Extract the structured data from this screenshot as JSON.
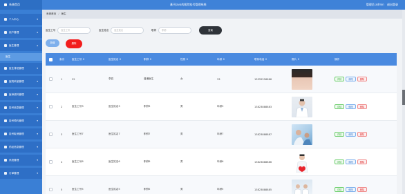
{
  "topbar": {
    "brand": "系统首页",
    "title": "基于Java的医院挂号管理系统",
    "user_role": "管理员 admin",
    "logout": "退出登录"
  },
  "sidebar": {
    "items": [
      {
        "label": "个人中心",
        "icon": "user-icon"
      },
      {
        "label": "用户管理",
        "icon": "users-icon"
      },
      {
        "label": "医生管理",
        "icon": "doctor-icon",
        "expanded": true,
        "sub": "医生"
      },
      {
        "label": "医生排班管理",
        "icon": "calendar-icon"
      },
      {
        "label": "医院科室管理",
        "icon": "hospital-icon"
      },
      {
        "label": "医师资料管理",
        "icon": "document-icon"
      },
      {
        "label": "挂号信息管理",
        "icon": "register-icon"
      },
      {
        "label": "挂号预约管理",
        "icon": "clock-icon"
      },
      {
        "label": "挂号取消管理",
        "icon": "cancel-icon"
      },
      {
        "label": "药品信息管理",
        "icon": "medicine-icon"
      },
      {
        "label": "系统管理",
        "icon": "gear-icon"
      },
      {
        "label": "订单管理",
        "icon": "order-icon"
      }
    ]
  },
  "breadcrumb": {
    "home": "系统首页",
    "separator": "/",
    "current": "医生"
  },
  "search": {
    "field1_label": "医生工号",
    "field1_placeholder": "医生工号",
    "field2_label": "医生姓名",
    "field2_placeholder": "医生姓名",
    "field3_label": "职称",
    "field3_placeholder": "职称",
    "button": "查询"
  },
  "toolbar": {
    "add": "新增",
    "delete": "删除"
  },
  "table": {
    "headers": [
      "索引",
      "医生工号 ⇕",
      "医生姓名 ⇕",
      "职称 ⇕",
      "性别 ⇕",
      "年龄 ⇕",
      "联系电话 ⇕",
      "照片 ⇕",
      "操作"
    ],
    "rows": [
      {
        "index": "1",
        "doc_no": "22",
        "name": "李四",
        "title": "普通医生",
        "gender": "女",
        "age": "33",
        "phone": "13555556666"
      },
      {
        "index": "2",
        "doc_no": "医生工号3",
        "name": "医生姓名3",
        "title": "职称3",
        "gender": "男",
        "age": "年龄3",
        "phone": "13823888883"
      },
      {
        "index": "3",
        "doc_no": "医生工号7",
        "name": "医生姓名7",
        "title": "职称7",
        "gender": "男",
        "age": "年龄7",
        "phone": "13823888887"
      },
      {
        "index": "4",
        "doc_no": "医生工号6",
        "name": "医生姓名6",
        "title": "职称6",
        "gender": "男",
        "age": "年龄6",
        "phone": "13823888886"
      },
      {
        "index": "5",
        "doc_no": "医生工号5",
        "name": "医生姓名5",
        "title": "职称5",
        "gender": "男",
        "age": "年龄5",
        "phone": "13823888885"
      }
    ],
    "actions": {
      "detail": "详情",
      "edit": "修改",
      "remove": "删除"
    }
  },
  "colors": {
    "topbar": "#3f82d8",
    "sidebar": "#3a7fd5",
    "header": "#4a8ae0",
    "delete": "#f21d1d",
    "search_button": "#2f3339"
  }
}
